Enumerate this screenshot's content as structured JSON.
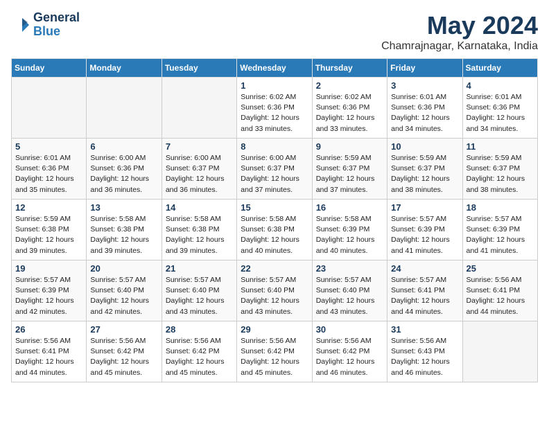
{
  "logo": {
    "line1": "General",
    "line2": "Blue"
  },
  "title": "May 2024",
  "subtitle": "Chamrajnagar, Karnataka, India",
  "weekdays": [
    "Sunday",
    "Monday",
    "Tuesday",
    "Wednesday",
    "Thursday",
    "Friday",
    "Saturday"
  ],
  "weeks": [
    [
      {
        "day": "",
        "info": ""
      },
      {
        "day": "",
        "info": ""
      },
      {
        "day": "",
        "info": ""
      },
      {
        "day": "1",
        "info": "Sunrise: 6:02 AM\nSunset: 6:36 PM\nDaylight: 12 hours\nand 33 minutes."
      },
      {
        "day": "2",
        "info": "Sunrise: 6:02 AM\nSunset: 6:36 PM\nDaylight: 12 hours\nand 33 minutes."
      },
      {
        "day": "3",
        "info": "Sunrise: 6:01 AM\nSunset: 6:36 PM\nDaylight: 12 hours\nand 34 minutes."
      },
      {
        "day": "4",
        "info": "Sunrise: 6:01 AM\nSunset: 6:36 PM\nDaylight: 12 hours\nand 34 minutes."
      }
    ],
    [
      {
        "day": "5",
        "info": "Sunrise: 6:01 AM\nSunset: 6:36 PM\nDaylight: 12 hours\nand 35 minutes."
      },
      {
        "day": "6",
        "info": "Sunrise: 6:00 AM\nSunset: 6:36 PM\nDaylight: 12 hours\nand 36 minutes."
      },
      {
        "day": "7",
        "info": "Sunrise: 6:00 AM\nSunset: 6:37 PM\nDaylight: 12 hours\nand 36 minutes."
      },
      {
        "day": "8",
        "info": "Sunrise: 6:00 AM\nSunset: 6:37 PM\nDaylight: 12 hours\nand 37 minutes."
      },
      {
        "day": "9",
        "info": "Sunrise: 5:59 AM\nSunset: 6:37 PM\nDaylight: 12 hours\nand 37 minutes."
      },
      {
        "day": "10",
        "info": "Sunrise: 5:59 AM\nSunset: 6:37 PM\nDaylight: 12 hours\nand 38 minutes."
      },
      {
        "day": "11",
        "info": "Sunrise: 5:59 AM\nSunset: 6:37 PM\nDaylight: 12 hours\nand 38 minutes."
      }
    ],
    [
      {
        "day": "12",
        "info": "Sunrise: 5:59 AM\nSunset: 6:38 PM\nDaylight: 12 hours\nand 39 minutes."
      },
      {
        "day": "13",
        "info": "Sunrise: 5:58 AM\nSunset: 6:38 PM\nDaylight: 12 hours\nand 39 minutes."
      },
      {
        "day": "14",
        "info": "Sunrise: 5:58 AM\nSunset: 6:38 PM\nDaylight: 12 hours\nand 39 minutes."
      },
      {
        "day": "15",
        "info": "Sunrise: 5:58 AM\nSunset: 6:38 PM\nDaylight: 12 hours\nand 40 minutes."
      },
      {
        "day": "16",
        "info": "Sunrise: 5:58 AM\nSunset: 6:39 PM\nDaylight: 12 hours\nand 40 minutes."
      },
      {
        "day": "17",
        "info": "Sunrise: 5:57 AM\nSunset: 6:39 PM\nDaylight: 12 hours\nand 41 minutes."
      },
      {
        "day": "18",
        "info": "Sunrise: 5:57 AM\nSunset: 6:39 PM\nDaylight: 12 hours\nand 41 minutes."
      }
    ],
    [
      {
        "day": "19",
        "info": "Sunrise: 5:57 AM\nSunset: 6:39 PM\nDaylight: 12 hours\nand 42 minutes."
      },
      {
        "day": "20",
        "info": "Sunrise: 5:57 AM\nSunset: 6:40 PM\nDaylight: 12 hours\nand 42 minutes."
      },
      {
        "day": "21",
        "info": "Sunrise: 5:57 AM\nSunset: 6:40 PM\nDaylight: 12 hours\nand 43 minutes."
      },
      {
        "day": "22",
        "info": "Sunrise: 5:57 AM\nSunset: 6:40 PM\nDaylight: 12 hours\nand 43 minutes."
      },
      {
        "day": "23",
        "info": "Sunrise: 5:57 AM\nSunset: 6:40 PM\nDaylight: 12 hours\nand 43 minutes."
      },
      {
        "day": "24",
        "info": "Sunrise: 5:57 AM\nSunset: 6:41 PM\nDaylight: 12 hours\nand 44 minutes."
      },
      {
        "day": "25",
        "info": "Sunrise: 5:56 AM\nSunset: 6:41 PM\nDaylight: 12 hours\nand 44 minutes."
      }
    ],
    [
      {
        "day": "26",
        "info": "Sunrise: 5:56 AM\nSunset: 6:41 PM\nDaylight: 12 hours\nand 44 minutes."
      },
      {
        "day": "27",
        "info": "Sunrise: 5:56 AM\nSunset: 6:42 PM\nDaylight: 12 hours\nand 45 minutes."
      },
      {
        "day": "28",
        "info": "Sunrise: 5:56 AM\nSunset: 6:42 PM\nDaylight: 12 hours\nand 45 minutes."
      },
      {
        "day": "29",
        "info": "Sunrise: 5:56 AM\nSunset: 6:42 PM\nDaylight: 12 hours\nand 45 minutes."
      },
      {
        "day": "30",
        "info": "Sunrise: 5:56 AM\nSunset: 6:42 PM\nDaylight: 12 hours\nand 46 minutes."
      },
      {
        "day": "31",
        "info": "Sunrise: 5:56 AM\nSunset: 6:43 PM\nDaylight: 12 hours\nand 46 minutes."
      },
      {
        "day": "",
        "info": ""
      }
    ]
  ]
}
